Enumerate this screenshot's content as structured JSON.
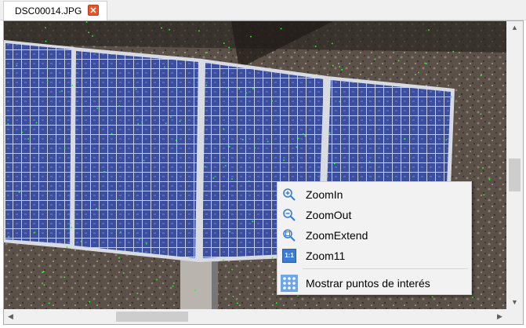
{
  "tab": {
    "title": "DSC00014.JPG",
    "close_glyph": "✕"
  },
  "viewer": {
    "image_description_icon": "solar-panel-photo",
    "overlay_point_color": "#22ff22"
  },
  "context_menu": {
    "items": [
      {
        "label": "ZoomIn",
        "icon": "zoom-in-icon"
      },
      {
        "label": "ZoomOut",
        "icon": "zoom-out-icon"
      },
      {
        "label": "ZoomExtend",
        "icon": "zoom-extend-icon"
      },
      {
        "label": "Zoom11",
        "icon": "zoom-1-1-icon",
        "icon_text": "1:1"
      },
      {
        "label": "Mostrar puntos de interés",
        "icon": "points-grid-icon"
      }
    ]
  },
  "scrollbars": {
    "vertical_position": 0.45,
    "horizontal_position": 0.29
  }
}
